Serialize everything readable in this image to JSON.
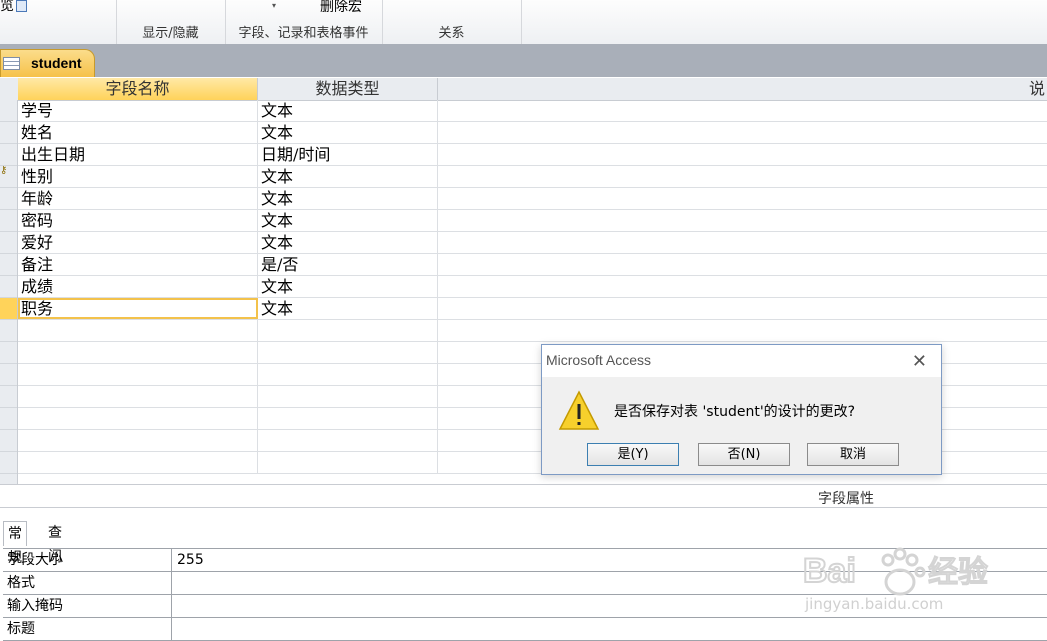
{
  "ribbon": {
    "preview_label": "览",
    "delete_macro_label": "删除宏",
    "dropdown_glyph": "▾",
    "groups": [
      {
        "label": "显示/隐藏"
      },
      {
        "label": "字段、记录和表格事件"
      },
      {
        "label": "关系"
      }
    ]
  },
  "tab": {
    "label": "student"
  },
  "grid": {
    "headers": {
      "name": "字段名称",
      "type": "数据类型",
      "description": "说"
    },
    "rows": [
      {
        "name": "学号",
        "type": "文本"
      },
      {
        "name": "姓名",
        "type": "文本"
      },
      {
        "name": "出生日期",
        "type": "日期/时间"
      },
      {
        "name": "性别",
        "type": "文本"
      },
      {
        "name": "年龄",
        "type": "文本"
      },
      {
        "name": "密码",
        "type": "文本"
      },
      {
        "name": "爱好",
        "type": "文本"
      },
      {
        "name": "备注",
        "type": "是/否"
      },
      {
        "name": "成绩",
        "type": "文本"
      },
      {
        "name": "职务",
        "type": "文本"
      }
    ]
  },
  "properties": {
    "title": "字段属性",
    "tabs": {
      "general": "常规",
      "lookup": "查阅"
    },
    "rows": [
      {
        "name": "字段大小",
        "value": "255"
      },
      {
        "name": "格式",
        "value": ""
      },
      {
        "name": "输入掩码",
        "value": ""
      },
      {
        "name": "标题",
        "value": ""
      }
    ]
  },
  "dialog": {
    "title": "Microsoft Access",
    "message": "是否保存对表 'student'的设计的更改?",
    "buttons": {
      "yes": "是(Y)",
      "no": "否(N)",
      "cancel": "取消"
    },
    "close_glyph": "✕"
  },
  "watermark": {
    "brand_left": "Bai",
    "brand_right": "经验",
    "url": "jingyan.baidu.com"
  },
  "colors": {
    "accent": "#ffd35a",
    "warning": "#f7d02c",
    "tabbar": "#a9afb9"
  }
}
